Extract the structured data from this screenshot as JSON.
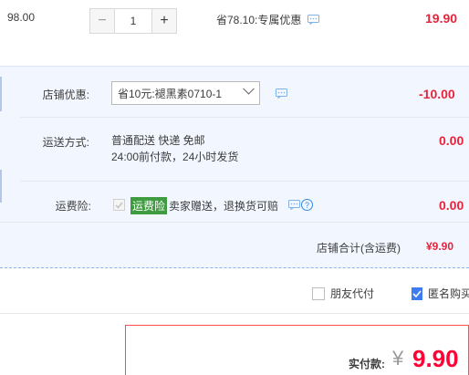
{
  "item": {
    "unit_price": "98.00",
    "quantity": "1",
    "minus_label": "−",
    "plus_label": "+",
    "promo": "省78.10:专属优惠",
    "subtotal": "19.90"
  },
  "shop": {
    "discount_label": "店铺优惠:",
    "discount_selected": "省10元:褪黑素0710-1",
    "discount_value": "-10.00",
    "shipping_label": "运送方式:",
    "shipping_line1": "普通配送 快递 免邮",
    "shipping_line2": "24:00前付款，24小时发货",
    "shipping_value": "0.00",
    "insurance_label": "运费险:",
    "insurance_badge": "运费险",
    "insurance_text": "卖家赠送，退换货可赔",
    "insurance_value": "0.00",
    "total_label": "店铺合计(含运费)",
    "total_value": "¥9.90"
  },
  "options": {
    "friend_pay": "朋友代付",
    "anonymous": "匿名购买"
  },
  "payment": {
    "label": "实付款:",
    "currency": "¥",
    "amount": "9.90"
  },
  "colors": {
    "accent_red": "#e5243c",
    "panel_bg": "#f2f7ff",
    "badge_green": "#3f9b3f",
    "checkbox_blue": "#3d7cf0"
  },
  "icons": [
    "chat-icon",
    "help-icon",
    "check-icon",
    "chevron-down-icon"
  ]
}
